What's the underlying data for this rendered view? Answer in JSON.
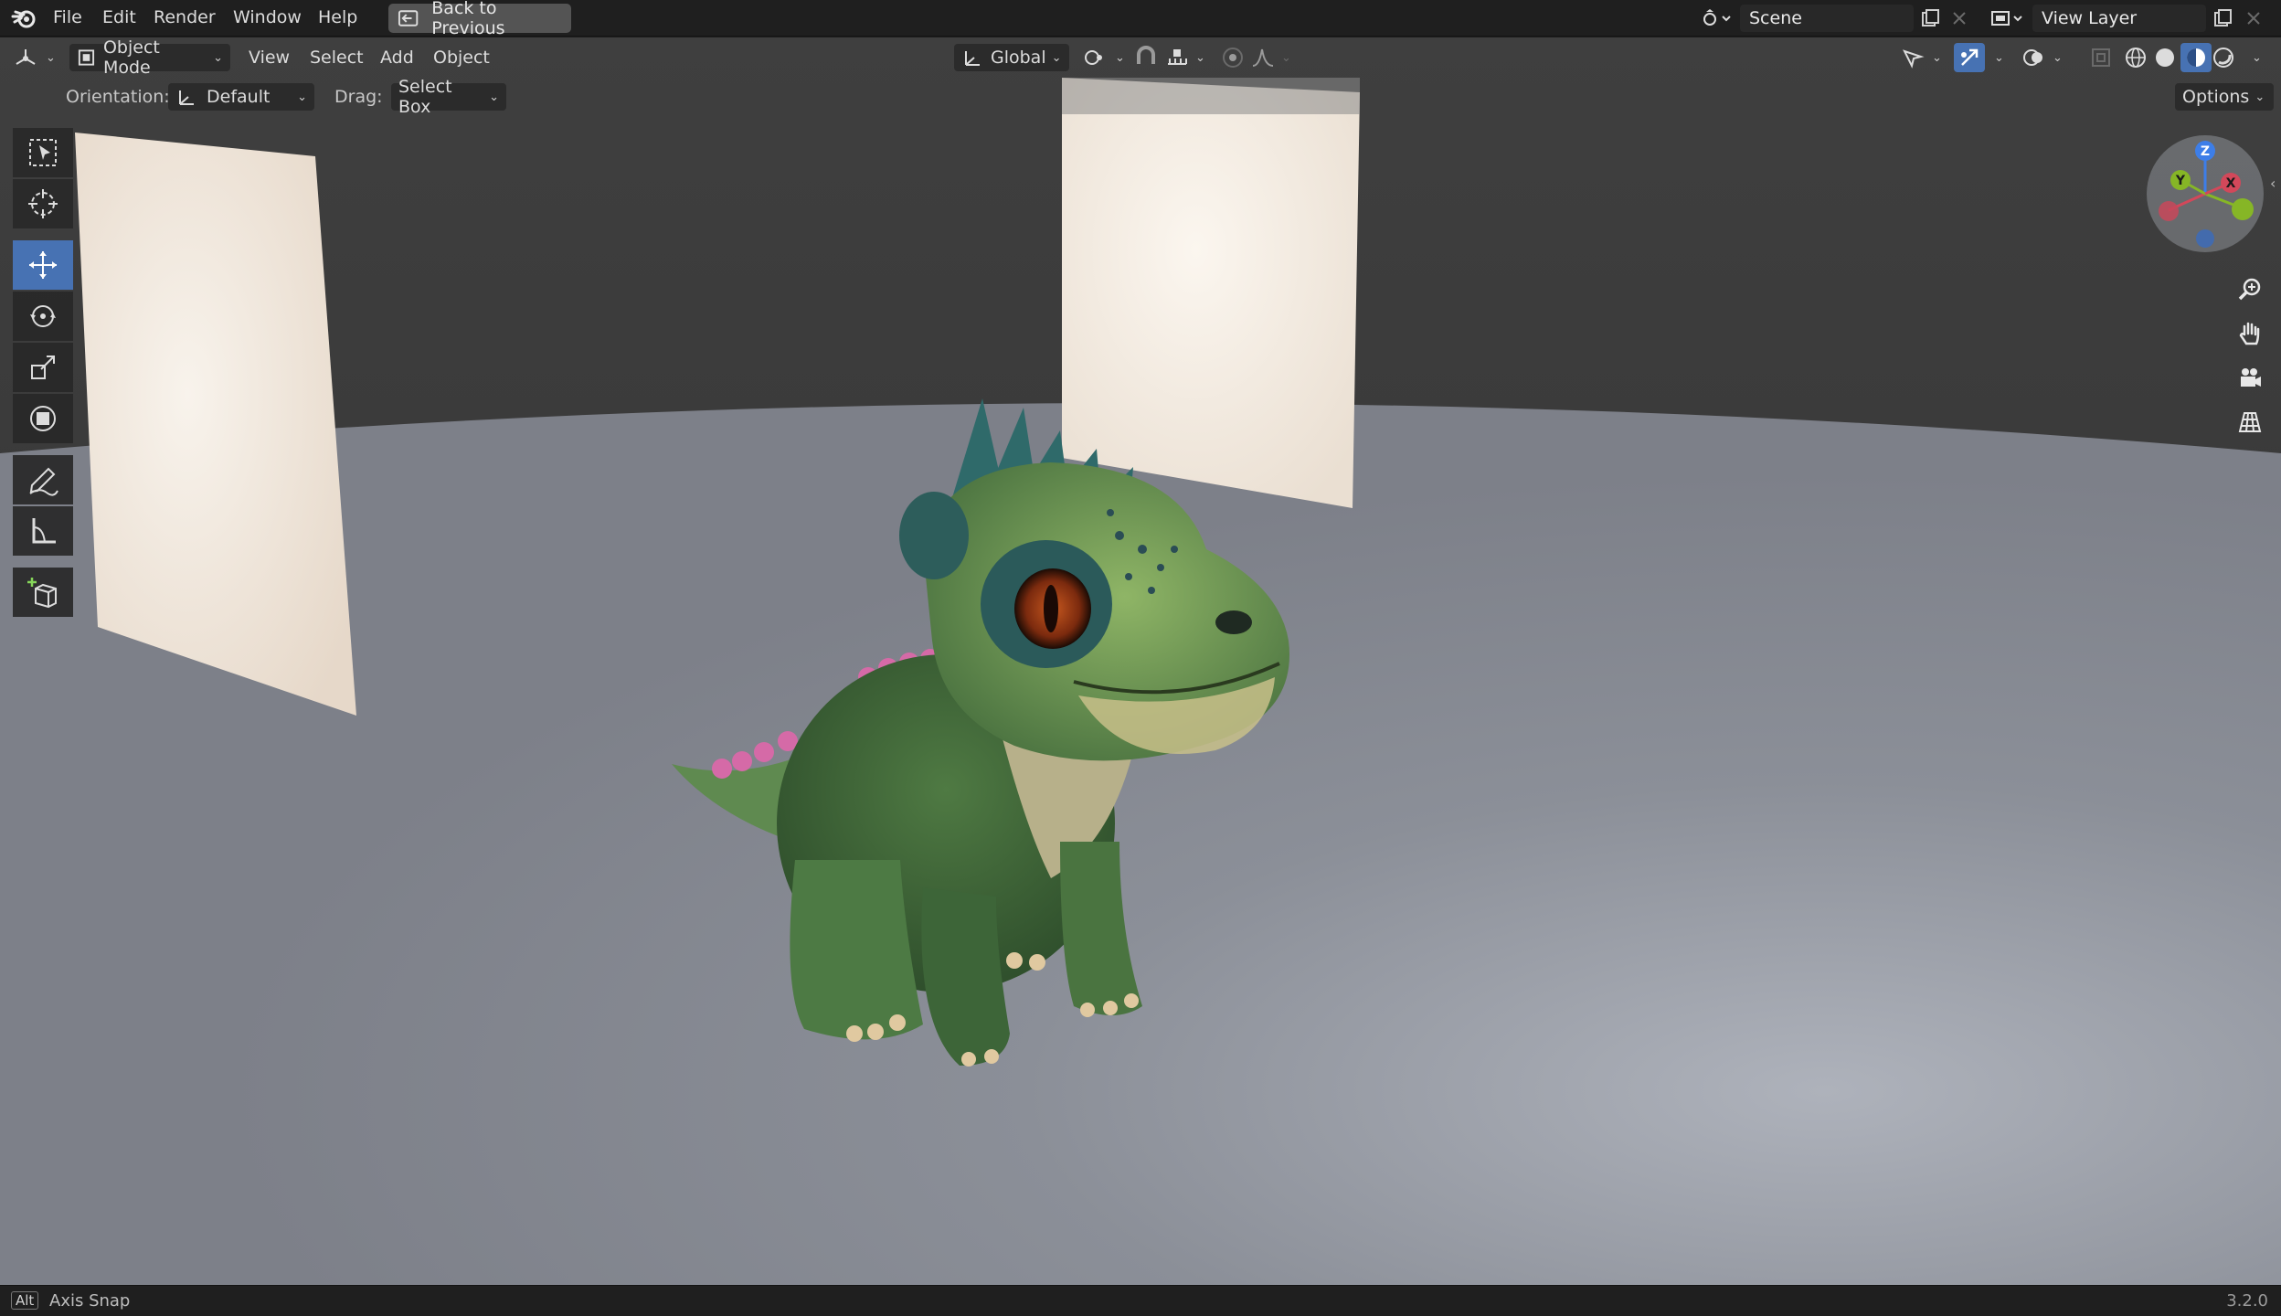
{
  "topbar": {
    "menu": [
      "File",
      "Edit",
      "Render",
      "Window",
      "Help"
    ],
    "back_button": "Back to Previous",
    "scene": "Scene",
    "view_layer": "View Layer"
  },
  "viewport_header": {
    "mode": "Object Mode",
    "menus": [
      "View",
      "Select",
      "Add",
      "Object"
    ],
    "transform_orientation": "Global"
  },
  "tool_settings": {
    "orientation_label": "Orientation:",
    "orientation_value": "Default",
    "drag_label": "Drag:",
    "drag_value": "Select Box",
    "options_label": "Options"
  },
  "gizmo": {
    "z": "Z",
    "y": "Y",
    "x": "X"
  },
  "statusbar": {
    "key": "Alt",
    "hint": "Axis Snap",
    "version": "3.2.0"
  },
  "colors": {
    "accent": "#4772b3",
    "header_bg": "#1f1f1f",
    "axis_x": "#d2485a",
    "axis_y": "#86b626",
    "axis_z": "#3d7ee8"
  },
  "tools": [
    "select-box",
    "cursor",
    "move",
    "rotate",
    "scale",
    "transform",
    "annotate",
    "measure",
    "add-cube"
  ]
}
